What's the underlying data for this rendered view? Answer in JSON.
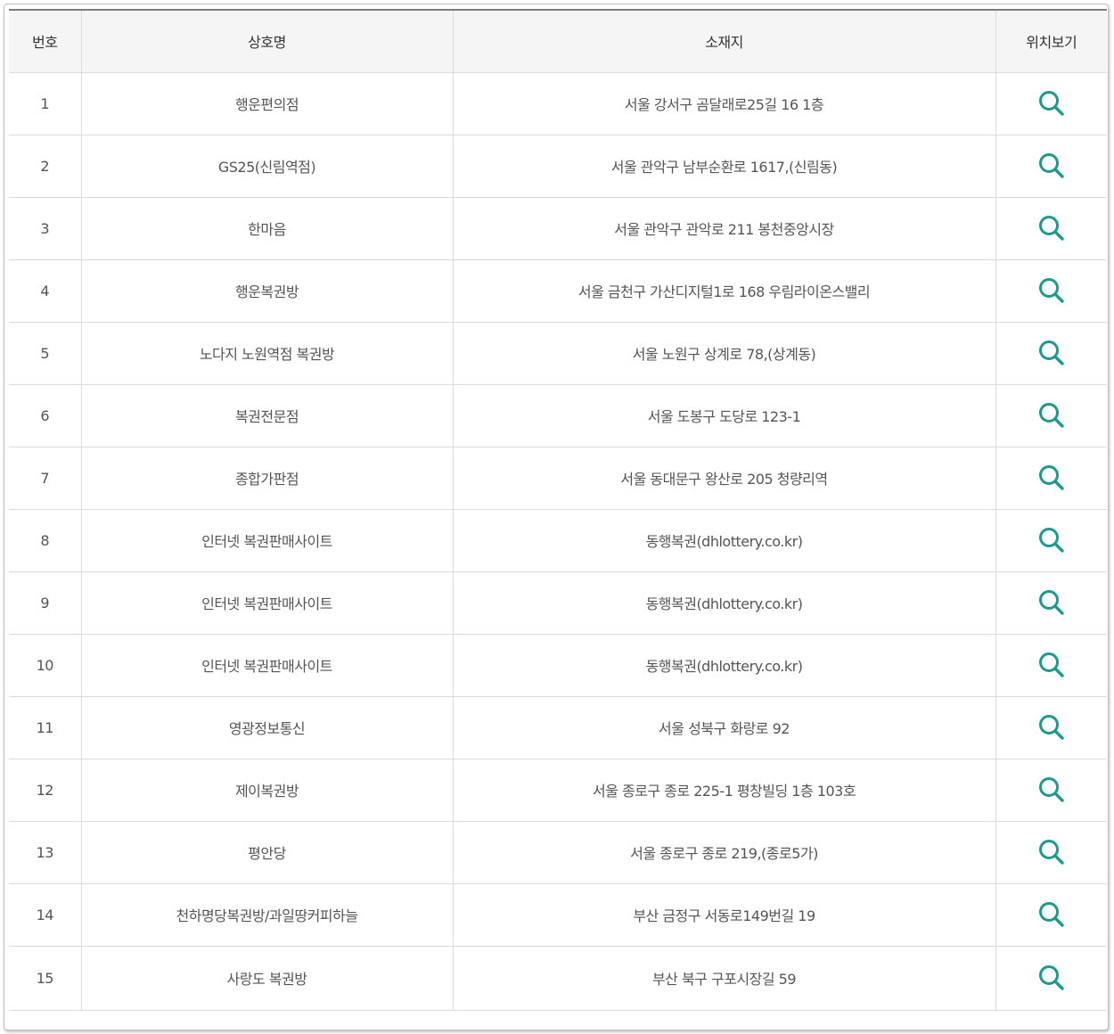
{
  "table": {
    "headers": {
      "no": "번호",
      "name": "상호명",
      "address": "소재지",
      "map": "위치보기"
    },
    "icon": "search-icon",
    "icon_color": "#1c9a8e",
    "rows": [
      {
        "no": "1",
        "name": "행운편의점",
        "address": "서울 강서구 곰달래로25길 16 1층"
      },
      {
        "no": "2",
        "name": "GS25(신림역점)",
        "address": "서울 관악구 남부순환로 1617,(신림동)"
      },
      {
        "no": "3",
        "name": "한마음",
        "address": "서울 관악구 관악로 211 봉천중앙시장"
      },
      {
        "no": "4",
        "name": "행운복권방",
        "address": "서울 금천구 가산디지털1로 168 우림라이온스밸리"
      },
      {
        "no": "5",
        "name": "노다지 노원역점 복권방",
        "address": "서울 노원구 상계로 78,(상계동)"
      },
      {
        "no": "6",
        "name": "복권전문점",
        "address": "서울 도봉구 도당로 123-1"
      },
      {
        "no": "7",
        "name": "종합가판점",
        "address": "서울 동대문구 왕산로 205 청량리역"
      },
      {
        "no": "8",
        "name": "인터넷 복권판매사이트",
        "address": "동행복권(dhlottery.co.kr)"
      },
      {
        "no": "9",
        "name": "인터넷 복권판매사이트",
        "address": "동행복권(dhlottery.co.kr)"
      },
      {
        "no": "10",
        "name": "인터넷 복권판매사이트",
        "address": "동행복권(dhlottery.co.kr)"
      },
      {
        "no": "11",
        "name": "영광정보통신",
        "address": "서울 성북구 화랑로 92"
      },
      {
        "no": "12",
        "name": "제이복권방",
        "address": "서울 종로구 종로 225-1 평창빌딩 1층 103호"
      },
      {
        "no": "13",
        "name": "평안당",
        "address": "서울 종로구 종로 219,(종로5가)"
      },
      {
        "no": "14",
        "name": "천하명당복권방/과일땅커피하늘",
        "address": "부산 금정구 서동로149번길 19"
      },
      {
        "no": "15",
        "name": "사랑도 복권방",
        "address": "부산 북구 구포시장길 59"
      }
    ]
  }
}
